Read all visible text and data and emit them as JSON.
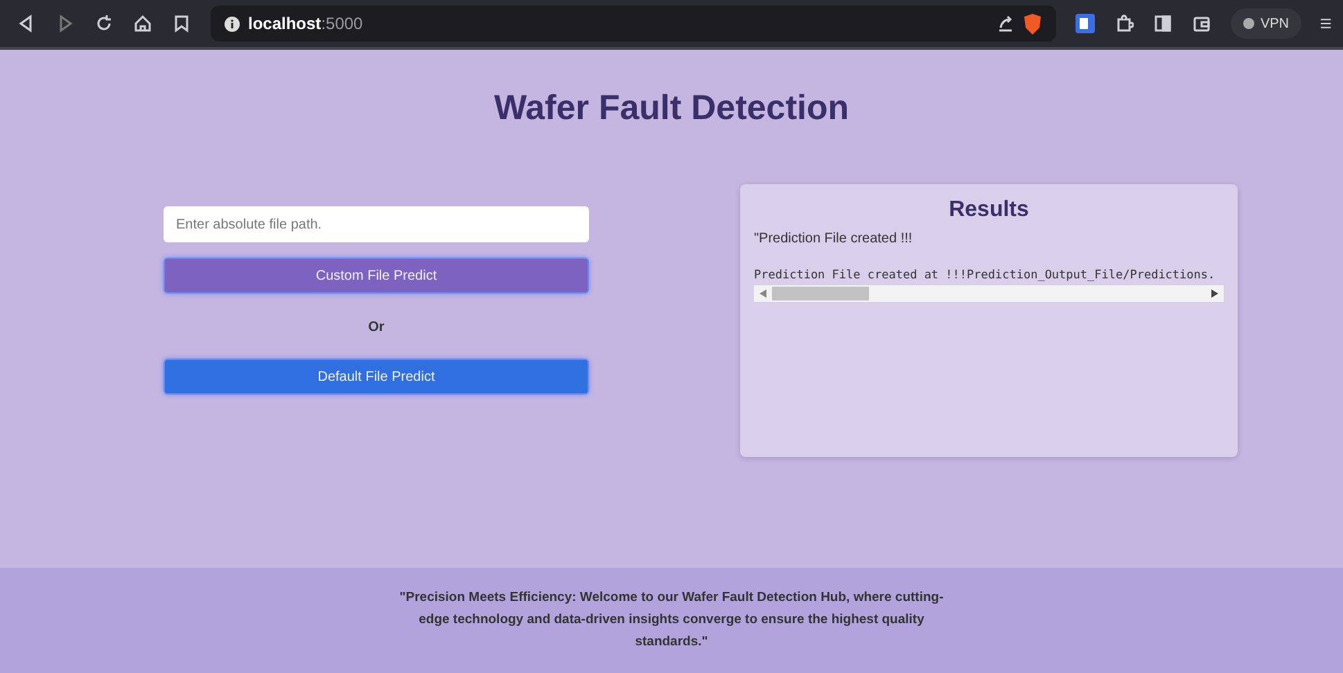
{
  "browser": {
    "url_host": "localhost",
    "url_port": ":5000",
    "vpn_label": "VPN"
  },
  "page": {
    "title": "Wafer Fault Detection"
  },
  "form": {
    "path_field": {
      "placeholder": "Enter absolute file path."
    },
    "custom_button": "Custom File Predict",
    "separator": "Or",
    "default_button": "Default File Predict"
  },
  "results": {
    "title": "Results",
    "message": "\"Prediction File created !!!",
    "output": "Prediction File created at !!!Prediction_Output_File/Predictions."
  },
  "footer": {
    "quote": "\"Precision Meets Efficiency: Welcome to our Wafer Fault Detection Hub, where cutting-edge technology and data-driven insights converge to ensure the highest quality standards.\""
  }
}
